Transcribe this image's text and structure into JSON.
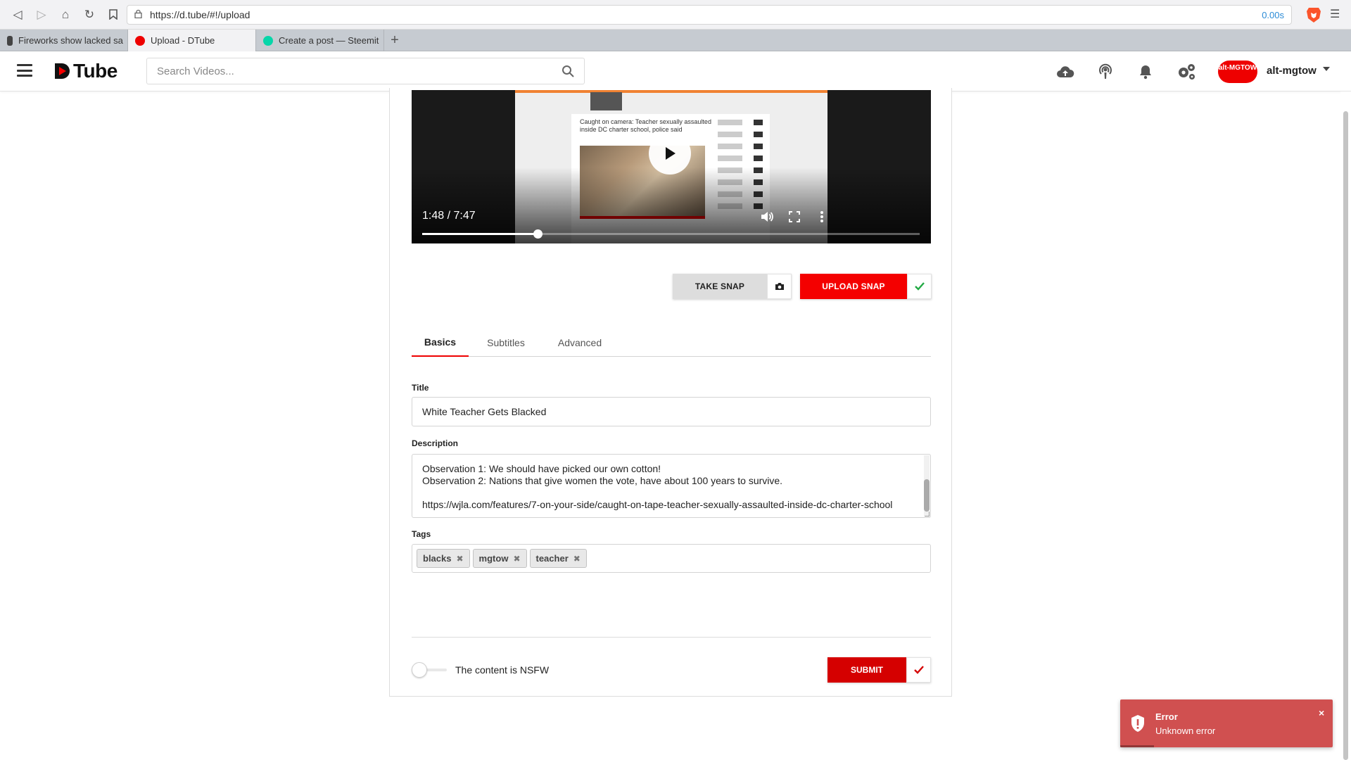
{
  "browser": {
    "url": "https://d.tube/#!/upload",
    "timer": "0.00s",
    "tabs": [
      {
        "title": "Fireworks show lacked sa",
        "active": false
      },
      {
        "title": "Upload - DTube",
        "active": true
      },
      {
        "title": "Create a post — Steemit",
        "active": false
      }
    ],
    "new_tab": "+"
  },
  "header": {
    "logo_text": "Tube",
    "search_placeholder": "Search Videos...",
    "avatar_text": "alt-MGTOW",
    "username": "alt-mgtow"
  },
  "video": {
    "time": "1:48 / 7:47",
    "progress": 0.2318,
    "headline": "Caught on camera: Teacher sexually assaulted inside DC charter school, police said"
  },
  "snap": {
    "take_label": "TAKE SNAP",
    "upload_label": "UPLOAD SNAP"
  },
  "form_tabs": [
    {
      "label": "Basics",
      "active": true
    },
    {
      "label": "Subtitles",
      "active": false
    },
    {
      "label": "Advanced",
      "active": false
    }
  ],
  "fields": {
    "title_label": "Title",
    "title_value": "White Teacher Gets Blacked",
    "description_label": "Description",
    "description_lines": [
      "Observation 1: We should have picked our own cotton!",
      "Observation 2: Nations that give women the vote, have about 100 years to survive.",
      "",
      "https://wjla.com/features/7-on-your-side/caught-on-tape-teacher-sexually-assaulted-inside-dc-charter-school"
    ],
    "tags_label": "Tags",
    "tags": [
      "blacks",
      "mgtow",
      "teacher"
    ]
  },
  "footer": {
    "nsfw_label": "The content is NSFW",
    "nsfw_checked": false,
    "submit_label": "SUBMIT"
  },
  "toast": {
    "title": "Error",
    "message": "Unknown error",
    "close": "×"
  },
  "colors": {
    "brand_red": "#f40000",
    "submit_red": "#d50000",
    "toast_bg": "#d05050",
    "check_green": "#22aa44"
  }
}
